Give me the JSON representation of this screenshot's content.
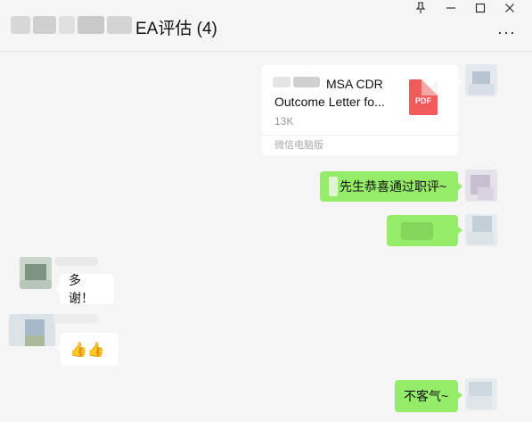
{
  "window": {
    "title": "EA评估 (4)",
    "pin_icon": "pin-icon",
    "minimize_icon": "minimize-icon",
    "maximize_icon": "maximize-icon",
    "close_icon": "close-icon",
    "more_icon": "more-icon"
  },
  "messages": {
    "file": {
      "name_line1": "MSA CDR",
      "name_line2": "Outcome Letter fo...",
      "size": "13K",
      "source": "微信电脑版",
      "type": "PDF"
    },
    "m2": {
      "text": "先生恭喜通过职评~"
    },
    "m4": {
      "text": "多谢！"
    },
    "m5": {
      "text": "👍👍"
    },
    "m6": {
      "text": "不客气~"
    }
  },
  "colors": {
    "self_bubble": "#95ec69",
    "other_bubble": "#ffffff",
    "background": "#f5f5f5",
    "pdf_red": "#f05a5a"
  }
}
